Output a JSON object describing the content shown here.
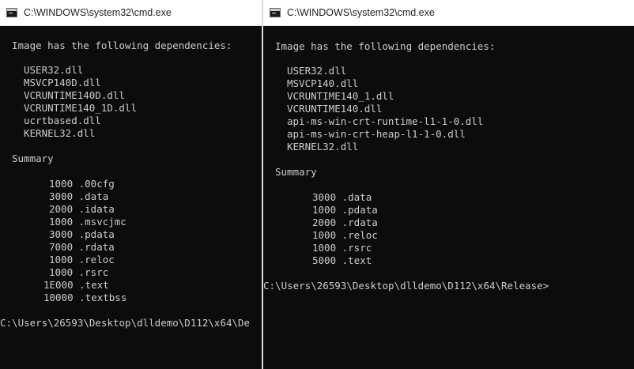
{
  "windows": [
    {
      "title": "C:\\WINDOWS\\system32\\cmd.exe",
      "header": "Image has the following dependencies:",
      "dependencies": [
        "USER32.dll",
        "MSVCP140D.dll",
        "VCRUNTIME140D.dll",
        "VCRUNTIME140_1D.dll",
        "ucrtbased.dll",
        "KERNEL32.dll"
      ],
      "summary_label": "Summary",
      "summary_rows": [
        "1000 .00cfg",
        "3000 .data",
        "2000 .idata",
        "1000 .msvcjmc",
        "3000 .pdata",
        "7000 .rdata",
        "1000 .reloc",
        "1000 .rsrc",
        "1E000 .text",
        "10000 .textbss"
      ],
      "prompt": "C:\\Users\\26593\\Desktop\\dlldemo\\D112\\x64\\De"
    },
    {
      "title": "C:\\WINDOWS\\system32\\cmd.exe",
      "header": "Image has the following dependencies:",
      "dependencies": [
        "USER32.dll",
        "MSVCP140.dll",
        "VCRUNTIME140_1.dll",
        "VCRUNTIME140.dll",
        "api-ms-win-crt-runtime-l1-1-0.dll",
        "api-ms-win-crt-heap-l1-1-0.dll",
        "KERNEL32.dll"
      ],
      "summary_label": "Summary",
      "summary_rows": [
        "3000 .data",
        "1000 .pdata",
        "2000 .rdata",
        "1000 .reloc",
        "1000 .rsrc",
        "5000 .text"
      ],
      "prompt": "C:\\Users\\26593\\Desktop\\dlldemo\\D112\\x64\\Release>"
    }
  ]
}
